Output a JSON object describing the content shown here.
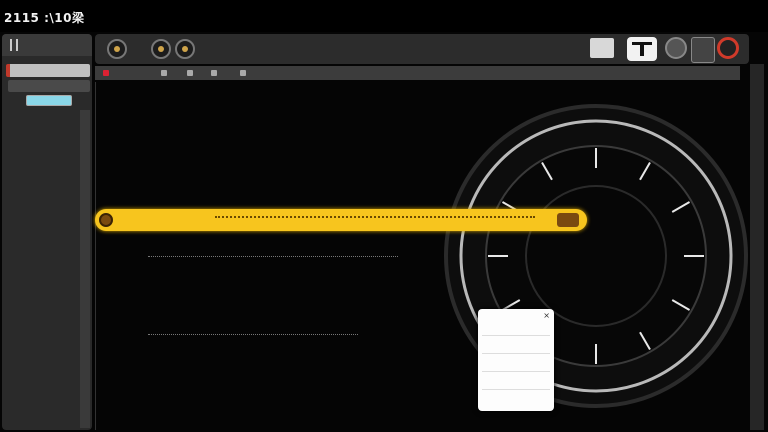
{
  "app": {
    "title": "2115 :\\10梁"
  },
  "left_panel": {
    "items": [
      "",
      "",
      "",
      "",
      "",
      "",
      "",
      "",
      ""
    ]
  },
  "toolbar": {
    "buttons": [
      "back-icon",
      "record-icon",
      "camera-icon"
    ]
  },
  "colors": {
    "accent_yellow": "#f7c51e",
    "accent_red": "#d03a2a",
    "gauge_ring": "#b9b9b9"
  }
}
